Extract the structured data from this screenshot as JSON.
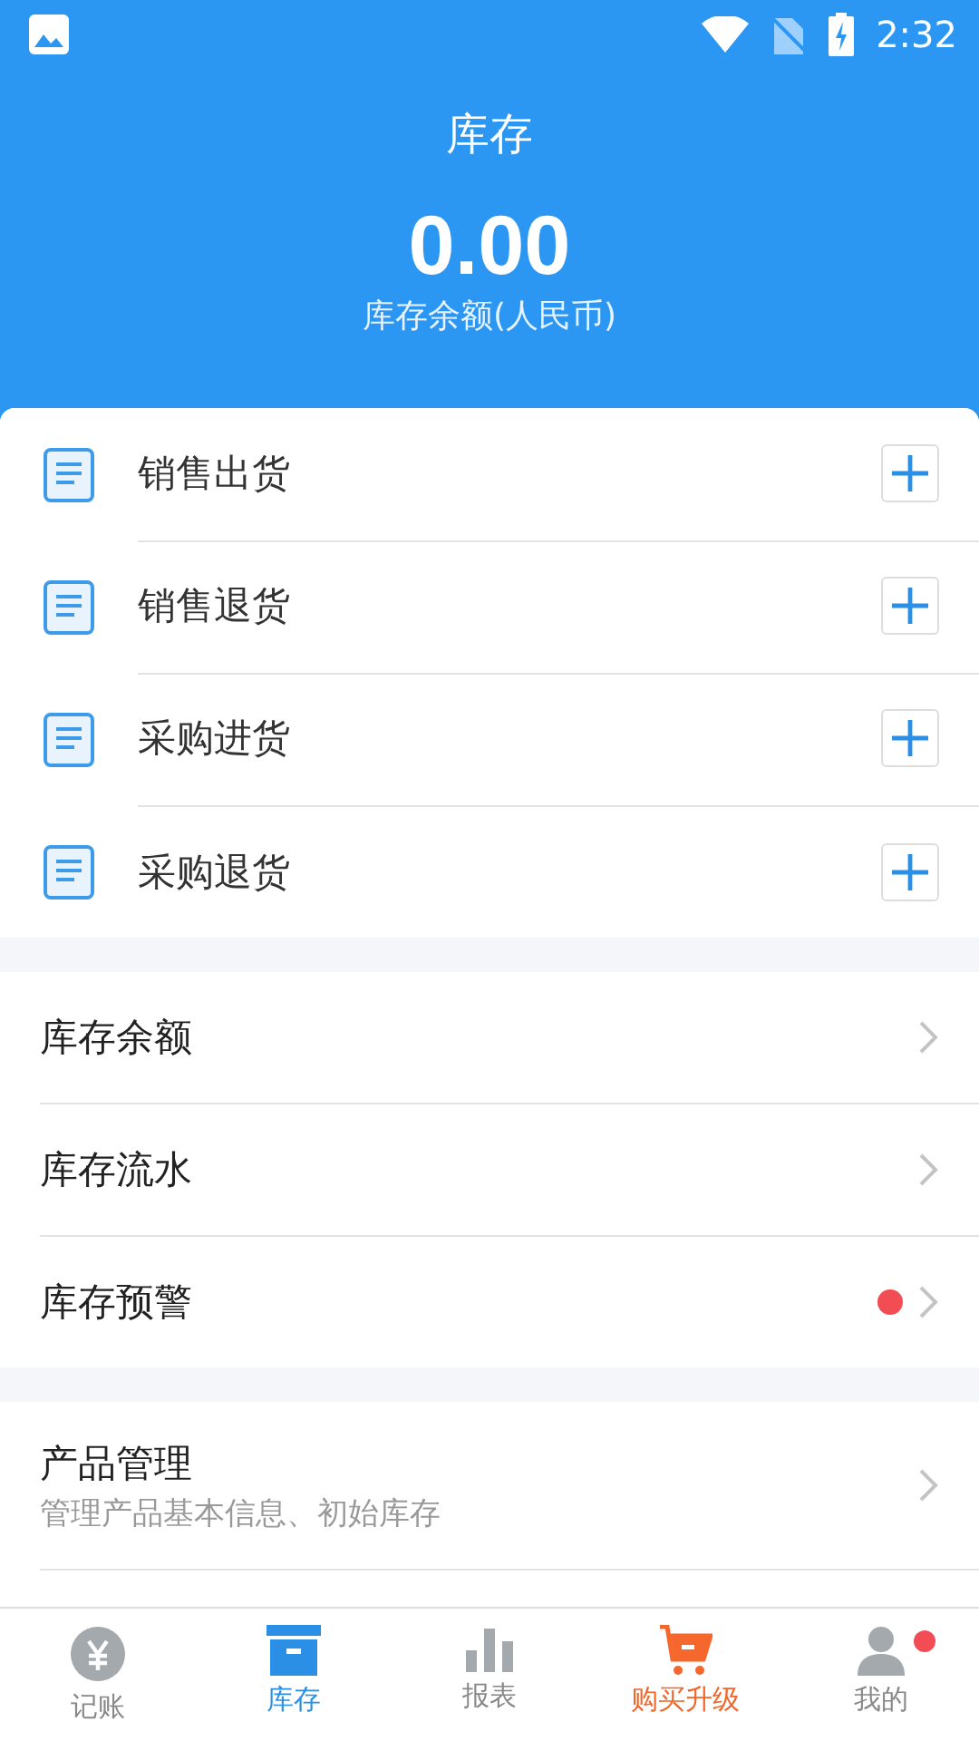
{
  "status_bar": {
    "time": "2:32"
  },
  "header": {
    "title": "库存",
    "amount": "0.00",
    "caption": "库存余额(人民币)"
  },
  "actions": [
    {
      "label": "销售出货"
    },
    {
      "label": "销售退货"
    },
    {
      "label": "采购进货"
    },
    {
      "label": "采购退货"
    }
  ],
  "menu": [
    {
      "label": "库存余额",
      "alert": false
    },
    {
      "label": "库存流水",
      "alert": false
    },
    {
      "label": "库存预警",
      "alert": true
    }
  ],
  "product": {
    "title": "产品管理",
    "subtitle": "管理产品基本信息、初始库存"
  },
  "tabs": [
    {
      "label": "记账",
      "kind": "yuan",
      "selected": false,
      "badge": false
    },
    {
      "label": "库存",
      "kind": "box",
      "selected": true,
      "badge": false
    },
    {
      "label": "报表",
      "kind": "chart",
      "selected": false,
      "badge": false
    },
    {
      "label": "购买升级",
      "kind": "cart",
      "selected": false,
      "badge": false
    },
    {
      "label": "我的",
      "kind": "user",
      "selected": false,
      "badge": true
    }
  ]
}
